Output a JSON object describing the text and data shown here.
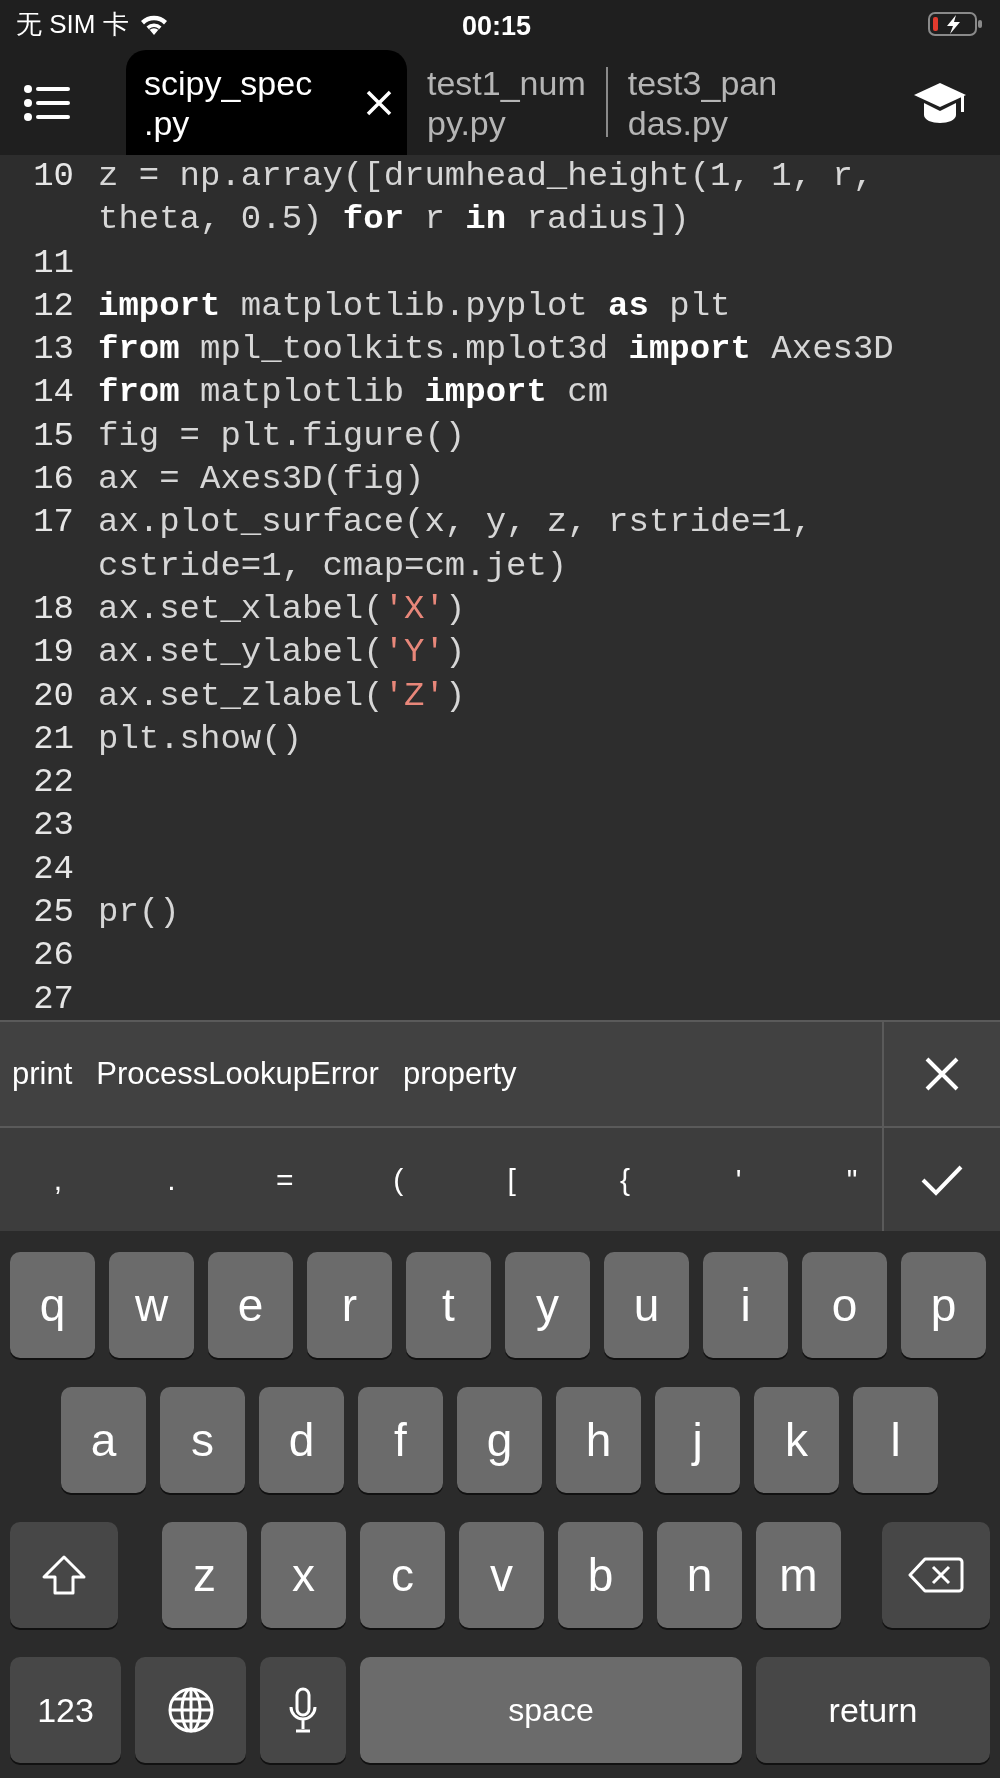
{
  "status_bar": {
    "carrier": "无 SIM 卡",
    "time": "00:15"
  },
  "tabs": [
    {
      "label": "scipy_spec\n.py",
      "selected": true
    },
    {
      "label": "test1_num\npy.py",
      "selected": false
    },
    {
      "label": "test3_pan\ndas.py",
      "selected": false
    }
  ],
  "editor": {
    "lines": [
      {
        "number": "10",
        "rows": [
          [
            {
              "kind": "plain",
              "text": "z = np.array([drumhead_height(1, 1, r,"
            }
          ],
          [
            {
              "kind": "plain",
              "text": "theta, 0.5) "
            },
            {
              "kind": "keyword",
              "text": "for"
            },
            {
              "kind": "plain",
              "text": " r "
            },
            {
              "kind": "keyword",
              "text": "in"
            },
            {
              "kind": "plain",
              "text": " radius])"
            }
          ]
        ]
      },
      {
        "number": "11",
        "rows": [
          []
        ]
      },
      {
        "number": "12",
        "rows": [
          [
            {
              "kind": "keyword",
              "text": "import"
            },
            {
              "kind": "plain",
              "text": " matplotlib.pyplot "
            },
            {
              "kind": "keyword",
              "text": "as"
            },
            {
              "kind": "plain",
              "text": " plt"
            }
          ]
        ]
      },
      {
        "number": "13",
        "rows": [
          [
            {
              "kind": "keyword",
              "text": "from"
            },
            {
              "kind": "plain",
              "text": " mpl_toolkits.mplot3d "
            },
            {
              "kind": "keyword",
              "text": "import"
            },
            {
              "kind": "plain",
              "text": " Axes3D"
            }
          ]
        ]
      },
      {
        "number": "14",
        "rows": [
          [
            {
              "kind": "keyword",
              "text": "from"
            },
            {
              "kind": "plain",
              "text": " matplotlib "
            },
            {
              "kind": "keyword",
              "text": "import"
            },
            {
              "kind": "plain",
              "text": " cm"
            }
          ]
        ]
      },
      {
        "number": "15",
        "rows": [
          [
            {
              "kind": "plain",
              "text": "fig = plt.figure()"
            }
          ]
        ]
      },
      {
        "number": "16",
        "rows": [
          [
            {
              "kind": "plain",
              "text": "ax = Axes3D(fig)"
            }
          ]
        ]
      },
      {
        "number": "17",
        "rows": [
          [
            {
              "kind": "plain",
              "text": "ax.plot_surface(x, y, z, rstride=1,"
            }
          ],
          [
            {
              "kind": "plain",
              "text": "cstride=1, cmap=cm.jet)"
            }
          ]
        ]
      },
      {
        "number": "18",
        "rows": [
          [
            {
              "kind": "plain",
              "text": "ax.set_xlabel("
            },
            {
              "kind": "string",
              "text": "'X'"
            },
            {
              "kind": "plain",
              "text": ")"
            }
          ]
        ]
      },
      {
        "number": "19",
        "rows": [
          [
            {
              "kind": "plain",
              "text": "ax.set_ylabel("
            },
            {
              "kind": "string",
              "text": "'Y'"
            },
            {
              "kind": "plain",
              "text": ")"
            }
          ]
        ]
      },
      {
        "number": "20",
        "rows": [
          [
            {
              "kind": "plain",
              "text": "ax.set_zlabel("
            },
            {
              "kind": "string",
              "text": "'Z'"
            },
            {
              "kind": "plain",
              "text": ")"
            }
          ]
        ]
      },
      {
        "number": "21",
        "rows": [
          [
            {
              "kind": "plain",
              "text": "plt.show()"
            }
          ]
        ]
      },
      {
        "number": "22",
        "rows": [
          []
        ]
      },
      {
        "number": "23",
        "rows": [
          []
        ]
      },
      {
        "number": "24",
        "rows": [
          []
        ]
      },
      {
        "number": "25",
        "rows": [
          [
            {
              "kind": "plain",
              "text": "pr()"
            }
          ]
        ]
      },
      {
        "number": "26",
        "rows": [
          []
        ]
      },
      {
        "number": "27",
        "rows": [
          []
        ]
      }
    ]
  },
  "suggestions": [
    "print",
    "ProcessLookupError",
    "property"
  ],
  "symbol_keys": [
    ",",
    ".",
    "=",
    "(",
    "[",
    "{",
    "'",
    "\""
  ],
  "keyboard": {
    "rows": [
      {
        "keys": [
          {
            "kind": "letter",
            "label": "q"
          },
          {
            "kind": "letter",
            "label": "w"
          },
          {
            "kind": "letter",
            "label": "e"
          },
          {
            "kind": "letter",
            "label": "r"
          },
          {
            "kind": "letter",
            "label": "t"
          },
          {
            "kind": "letter",
            "label": "y"
          },
          {
            "kind": "letter",
            "label": "u"
          },
          {
            "kind": "letter",
            "label": "i"
          },
          {
            "kind": "letter",
            "label": "o"
          },
          {
            "kind": "letter",
            "label": "p"
          }
        ]
      },
      {
        "keys": [
          {
            "kind": "letter",
            "label": "a"
          },
          {
            "kind": "letter",
            "label": "s"
          },
          {
            "kind": "letter",
            "label": "d"
          },
          {
            "kind": "letter",
            "label": "f"
          },
          {
            "kind": "letter",
            "label": "g"
          },
          {
            "kind": "letter",
            "label": "h"
          },
          {
            "kind": "letter",
            "label": "j"
          },
          {
            "kind": "letter",
            "label": "k"
          },
          {
            "kind": "letter",
            "label": "l"
          }
        ]
      },
      {
        "keys": [
          {
            "kind": "shift"
          },
          {
            "kind": "letter",
            "label": "z"
          },
          {
            "kind": "letter",
            "label": "x"
          },
          {
            "kind": "letter",
            "label": "c"
          },
          {
            "kind": "letter",
            "label": "v"
          },
          {
            "kind": "letter",
            "label": "b"
          },
          {
            "kind": "letter",
            "label": "n"
          },
          {
            "kind": "letter",
            "label": "m"
          },
          {
            "kind": "delete"
          }
        ]
      },
      {
        "keys": [
          {
            "kind": "mode",
            "label": "123"
          },
          {
            "kind": "globe"
          },
          {
            "kind": "mic"
          },
          {
            "kind": "space",
            "label": "space"
          },
          {
            "kind": "return",
            "label": "return"
          }
        ]
      }
    ]
  }
}
